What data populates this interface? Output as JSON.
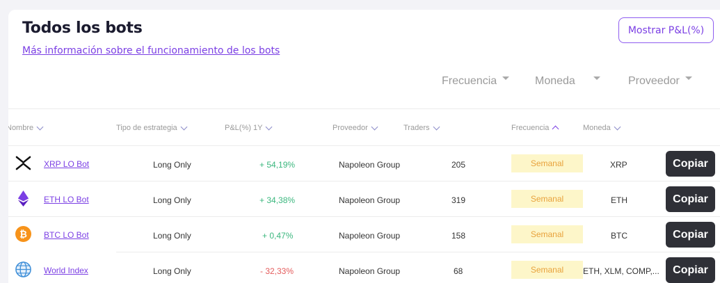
{
  "header": {
    "title": "Todos los bots",
    "info_link": "Más información sobre el funcionamiento de los bots",
    "pl_button": "Mostrar P&L(%)"
  },
  "filters": {
    "frecuencia": "Frecuencia",
    "moneda": "Moneda",
    "proveedor": "Proveedor"
  },
  "columns": {
    "nombre": "Nombre",
    "tipo": "Tipo de estrategia",
    "pl": "P&L(%) 1Y",
    "proveedor": "Proveedor",
    "traders": "Traders",
    "frecuencia": "Frecuencia",
    "moneda": "Moneda"
  },
  "rows": [
    {
      "name": "XRP LO Bot",
      "icon": "xrp-icon",
      "strategy": "Long Only",
      "pl": "+ 54,19%",
      "pl_sign": "positive",
      "provider": "Napoleon Group",
      "traders": "205",
      "frequency": "Semanal",
      "currency": "XRP",
      "action": "Copiar"
    },
    {
      "name": "ETH LO Bot",
      "icon": "eth-icon",
      "strategy": "Long Only",
      "pl": "+ 34,38%",
      "pl_sign": "positive",
      "provider": "Napoleon Group",
      "traders": "319",
      "frequency": "Semanal",
      "currency": "ETH",
      "action": "Copiar"
    },
    {
      "name": "BTC LO Bot",
      "icon": "btc-icon",
      "strategy": "Long Only",
      "pl": "+ 0,47%",
      "pl_sign": "positive",
      "provider": "Napoleon Group",
      "traders": "158",
      "frequency": "Semanal",
      "currency": "BTC",
      "action": "Copiar"
    },
    {
      "name": "World Index",
      "icon": "globe-icon",
      "strategy": "Long Only",
      "pl": "- 32,33%",
      "pl_sign": "negative",
      "provider": "Napoleon Group",
      "traders": "68",
      "frequency": "Semanal",
      "currency": "ETH, XLM, COMP,...",
      "action": "Copiar"
    }
  ],
  "colors": {
    "accent": "#7b3fe4",
    "positive": "#3bb77e",
    "negative": "#e45b5b",
    "frequency_bg": "#fdf6c9",
    "frequency_text": "#e8a23c",
    "button_bg": "#2f3037"
  }
}
